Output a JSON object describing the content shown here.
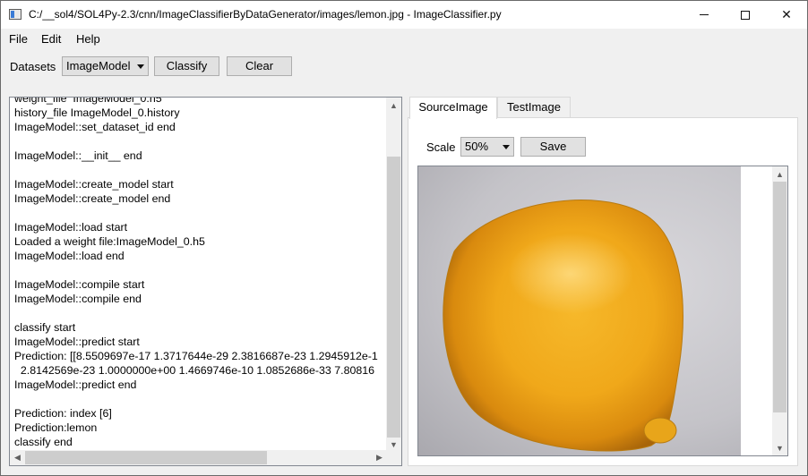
{
  "window": {
    "title": "C:/__sol4/SOL4Py-2.3/cnn/ImageClassifierByDataGenerator/images/lemon.jpg - ImageClassifier.py",
    "min_glyph": "",
    "max_glyph": "",
    "close_glyph": "✕"
  },
  "menu": {
    "file": "File",
    "edit": "Edit",
    "help": "Help"
  },
  "toolbar": {
    "datasets_label": "Datasets",
    "datasets_value": "ImageModel",
    "classify_label": "Classify",
    "clear_label": "Clear"
  },
  "log": {
    "lines": "weight_file  ImageModel_0.h5\nhistory_file ImageModel_0.history\nImageModel::set_dataset_id end\n\nImageModel::__init__ end\n\nImageModel::create_model start\nImageModel::create_model end\n\nImageModel::load start\nLoaded a weight file:ImageModel_0.h5\nImageModel::load end\n\nImageModel::compile start\nImageModel::compile end\n\nclassify start\nImageModel::predict start\nPrediction: [[8.5509697e-17 1.3717644e-29 2.3816687e-23 1.2945912e-1\n  2.8142569e-23 1.0000000e+00 1.4669746e-10 1.0852686e-33 7.80816\nImageModel::predict end\n\nPrediction: index [6]\nPrediction:lemon\nclassify end"
  },
  "tabs": {
    "source": "SourceImage",
    "test": "TestImage"
  },
  "image_panel": {
    "scale_label": "Scale",
    "scale_value": "50%",
    "save_label": "Save"
  },
  "icons": {
    "up_arrow": "▲",
    "down_arrow": "▼",
    "left_arrow": "◀",
    "right_arrow": "▶"
  },
  "colors": {
    "lemon": "#f0a81a",
    "background": "#c4c3c8"
  }
}
